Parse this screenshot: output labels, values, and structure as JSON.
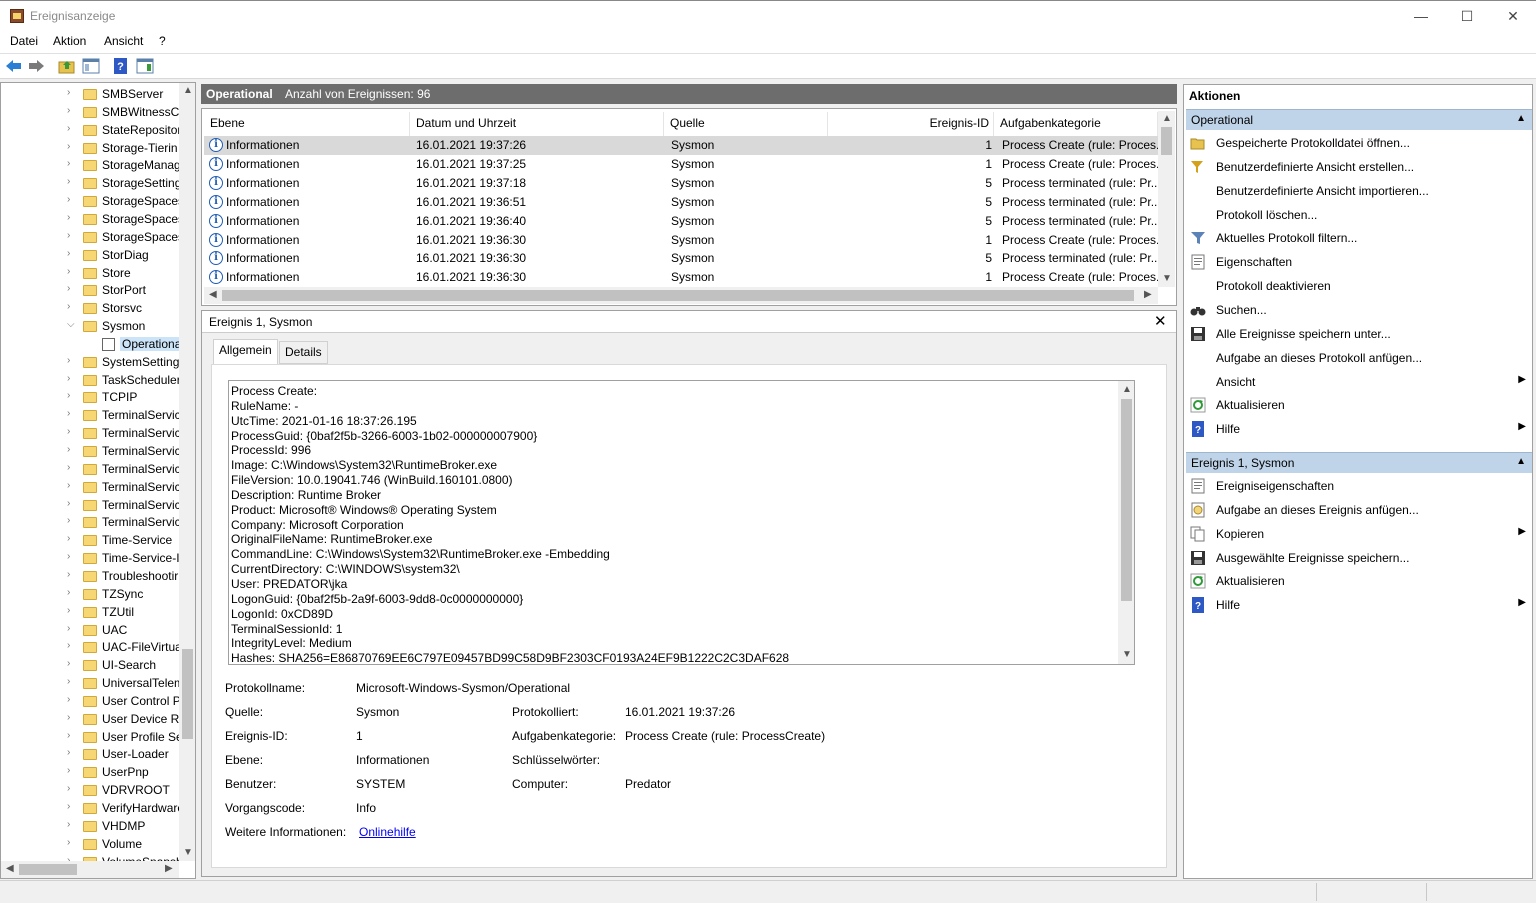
{
  "window": {
    "title": "Ereignisanzeige",
    "minimize": "—",
    "maximize": "☐",
    "close": "✕"
  },
  "menu": [
    "Datei",
    "Aktion",
    "Ansicht",
    "?"
  ],
  "tree": {
    "items": [
      {
        "label": "SMBServer"
      },
      {
        "label": "SMBWitnessCl"
      },
      {
        "label": "StateRepositor"
      },
      {
        "label": "Storage-Tierin"
      },
      {
        "label": "StorageManag"
      },
      {
        "label": "StorageSetting"
      },
      {
        "label": "StorageSpaces"
      },
      {
        "label": "StorageSpaces"
      },
      {
        "label": "StorageSpaces"
      },
      {
        "label": "StorDiag"
      },
      {
        "label": "Store"
      },
      {
        "label": "StorPort"
      },
      {
        "label": "Storsvc"
      },
      {
        "label": "Sysmon",
        "expanded": true
      },
      {
        "label": "Operational",
        "child": true,
        "selected": true
      },
      {
        "label": "SystemSetting"
      },
      {
        "label": "TaskScheduler"
      },
      {
        "label": "TCPIP"
      },
      {
        "label": "TerminalServic"
      },
      {
        "label": "TerminalServic"
      },
      {
        "label": "TerminalServic"
      },
      {
        "label": "TerminalServic"
      },
      {
        "label": "TerminalServic"
      },
      {
        "label": "TerminalServic"
      },
      {
        "label": "TerminalServic"
      },
      {
        "label": "Time-Service"
      },
      {
        "label": "Time-Service-I"
      },
      {
        "label": "Troubleshootir"
      },
      {
        "label": "TZSync"
      },
      {
        "label": "TZUtil"
      },
      {
        "label": "UAC"
      },
      {
        "label": "UAC-FileVirtua"
      },
      {
        "label": "UI-Search"
      },
      {
        "label": "UniversalTelem"
      },
      {
        "label": "User Control P"
      },
      {
        "label": "User Device Re"
      },
      {
        "label": "User Profile Se"
      },
      {
        "label": "User-Loader"
      },
      {
        "label": "UserPnp"
      },
      {
        "label": "VDRVROOT"
      },
      {
        "label": "VerifyHardware"
      },
      {
        "label": "VHDMP"
      },
      {
        "label": "Volume"
      },
      {
        "label": "VolumeSnapsh"
      }
    ]
  },
  "events": {
    "log_name": "Operational",
    "count_label": "Anzahl von Ereignissen: 96",
    "columns": [
      "Ebene",
      "Datum und Uhrzeit",
      "Quelle",
      "Ereignis-ID",
      "Aufgabenkategorie"
    ],
    "rows": [
      {
        "level": "Informationen",
        "date": "16.01.2021 19:37:26",
        "source": "Sysmon",
        "id": "1",
        "category": "Process Create (rule: Proces..."
      },
      {
        "level": "Informationen",
        "date": "16.01.2021 19:37:25",
        "source": "Sysmon",
        "id": "1",
        "category": "Process Create (rule: Proces..."
      },
      {
        "level": "Informationen",
        "date": "16.01.2021 19:37:18",
        "source": "Sysmon",
        "id": "5",
        "category": "Process terminated (rule: Pr..."
      },
      {
        "level": "Informationen",
        "date": "16.01.2021 19:36:51",
        "source": "Sysmon",
        "id": "5",
        "category": "Process terminated (rule: Pr..."
      },
      {
        "level": "Informationen",
        "date": "16.01.2021 19:36:40",
        "source": "Sysmon",
        "id": "5",
        "category": "Process terminated (rule: Pr..."
      },
      {
        "level": "Informationen",
        "date": "16.01.2021 19:36:30",
        "source": "Sysmon",
        "id": "1",
        "category": "Process Create (rule: Proces..."
      },
      {
        "level": "Informationen",
        "date": "16.01.2021 19:36:30",
        "source": "Sysmon",
        "id": "5",
        "category": "Process terminated (rule: Pr..."
      },
      {
        "level": "Informationen",
        "date": "16.01.2021 19:36:30",
        "source": "Sysmon",
        "id": "1",
        "category": "Process Create (rule: Proces..."
      }
    ]
  },
  "detail": {
    "title": "Ereignis 1, Sysmon",
    "close": "✕",
    "tabs": [
      "Allgemein",
      "Details"
    ],
    "description": [
      "Process Create:",
      "RuleName: -",
      "UtcTime: 2021-01-16 18:37:26.195",
      "ProcessGuid: {0baf2f5b-3266-6003-1b02-000000007900}",
      "ProcessId: 996",
      "Image: C:\\Windows\\System32\\RuntimeBroker.exe",
      "FileVersion: 10.0.19041.746 (WinBuild.160101.0800)",
      "Description: Runtime Broker",
      "Product: Microsoft® Windows® Operating System",
      "Company: Microsoft Corporation",
      "OriginalFileName: RuntimeBroker.exe",
      "CommandLine: C:\\Windows\\System32\\RuntimeBroker.exe -Embedding",
      "CurrentDirectory: C:\\WINDOWS\\system32\\",
      "User: PREDATOR\\jka",
      "LogonGuid: {0baf2f5b-2a9f-6003-9dd8-0c0000000000}",
      "LogonId: 0xCD89D",
      "TerminalSessionId: 1",
      "IntegrityLevel: Medium",
      "Hashes: SHA256=E86870769EE6C797E09457BD99C58D9BF2303CF0193A24EF9B1222C2C3DAF628"
    ],
    "props": {
      "logname_label": "Protokollname:",
      "logname_value": "Microsoft-Windows-Sysmon/Operational",
      "source_label": "Quelle:",
      "source_value": "Sysmon",
      "logged_label": "Protokolliert:",
      "logged_value": "16.01.2021 19:37:26",
      "eventid_label": "Ereignis-ID:",
      "eventid_value": "1",
      "taskcat_label": "Aufgabenkategorie:",
      "taskcat_value": "Process Create (rule: ProcessCreate)",
      "level_label": "Ebene:",
      "level_value": "Informationen",
      "keywords_label": "Schlüsselwörter:",
      "keywords_value": "",
      "user_label": "Benutzer:",
      "user_value": "SYSTEM",
      "computer_label": "Computer:",
      "computer_value": "Predator",
      "opcode_label": "Vorgangscode:",
      "opcode_value": "Info",
      "moreinfo_label": "Weitere Informationen:",
      "moreinfo_link": "Onlinehilfe"
    }
  },
  "actions": {
    "title": "Aktionen",
    "section1": {
      "label": "Operational",
      "items": [
        {
          "label": "Gespeicherte Protokolldatei öffnen...",
          "icon": "open-folder-icon"
        },
        {
          "label": "Benutzerdefinierte Ansicht erstellen...",
          "icon": "filter-create-icon"
        },
        {
          "label": "Benutzerdefinierte Ansicht importieren...",
          "icon": ""
        },
        {
          "label": "Protokoll löschen...",
          "icon": ""
        },
        {
          "label": "Aktuelles Protokoll filtern...",
          "icon": "filter-icon"
        },
        {
          "label": "Eigenschaften",
          "icon": "properties-icon"
        },
        {
          "label": "Protokoll deaktivieren",
          "icon": ""
        },
        {
          "label": "Suchen...",
          "icon": "binoculars-icon"
        },
        {
          "label": "Alle Ereignisse speichern unter...",
          "icon": "save-icon"
        },
        {
          "label": "Aufgabe an dieses Protokoll anfügen...",
          "icon": ""
        },
        {
          "label": "Ansicht",
          "icon": "",
          "submenu": true
        },
        {
          "label": "Aktualisieren",
          "icon": "refresh-icon"
        },
        {
          "label": "Hilfe",
          "icon": "help-icon",
          "submenu": true
        }
      ]
    },
    "section2": {
      "label": "Ereignis 1, Sysmon",
      "items": [
        {
          "label": "Ereigniseigenschaften",
          "icon": "properties-icon"
        },
        {
          "label": "Aufgabe an dieses Ereignis anfügen...",
          "icon": "task-icon"
        },
        {
          "label": "Kopieren",
          "icon": "copy-icon",
          "submenu": true
        },
        {
          "label": "Ausgewählte Ereignisse speichern...",
          "icon": "save-icon"
        },
        {
          "label": "Aktualisieren",
          "icon": "refresh-icon"
        },
        {
          "label": "Hilfe",
          "icon": "help-icon",
          "submenu": true
        }
      ]
    }
  }
}
